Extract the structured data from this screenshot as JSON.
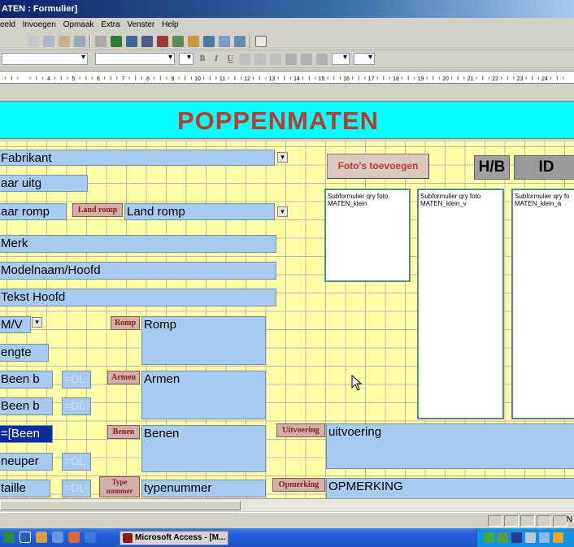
{
  "window": {
    "title": "ATEN : Formulier]"
  },
  "menu": [
    "eeld",
    "Invoegen",
    "Opmaak",
    "Extra",
    "Venster",
    "Help"
  ],
  "toolbar2": {
    "bold": "B",
    "italic": "I",
    "underline": "U"
  },
  "ruler": {
    "labels": [
      "4",
      "5",
      "6",
      "7",
      "8",
      "9",
      "10",
      "11",
      "12",
      "13",
      "14",
      "15",
      "16",
      "17",
      "18",
      "19",
      "20",
      "21",
      "22",
      "23",
      "24"
    ]
  },
  "form": {
    "title": "POPPENMATEN",
    "fields": {
      "fabrikant": "Fabrikant",
      "jaar_uitg": "aar uitg",
      "jaar_romp": "aar romp",
      "land_romp": "Land romp",
      "merk": "Merk",
      "modelnaam": "Modelnaam/Hoofd",
      "tekst_hoofd": "Tekst Hoofd",
      "mv": "M/V",
      "lengte": "engte",
      "been1": "Been b",
      "been2": "Been b",
      "been_expr": "=[Been",
      "heuper": "neuper",
      "taille": "taille",
      "dl": "=DL",
      "romp": "Romp",
      "armen": "Armen",
      "benen": "Benen",
      "typenummer": "typenummer",
      "uitvoering": "uitvoering",
      "opmerking": "OPMERKING"
    },
    "labels": {
      "land_romp": "Land romp",
      "romp": "Romp",
      "armen": "Armen",
      "benen": "Benen",
      "type": "Type",
      "nummer": "nummer",
      "uitvoering": "Uitvoering",
      "opmerking": "Opmerking"
    },
    "buttons": {
      "foto": "Foto's toevoegen"
    },
    "headers": {
      "hb": "H/B",
      "id": "ID"
    },
    "subforms": [
      {
        "line1": "Subformulier qry foto",
        "line2": "MATEN_klein"
      },
      {
        "line1": "Subformulier qry foto",
        "line2": "MATEN_klein_v"
      },
      {
        "line1": "Subformulier qry fo",
        "line2": "MATEN_klein_a"
      }
    ]
  },
  "status": {
    "text": "N"
  },
  "taskbar": {
    "access_label": "Microsoft Access - [M..."
  }
}
